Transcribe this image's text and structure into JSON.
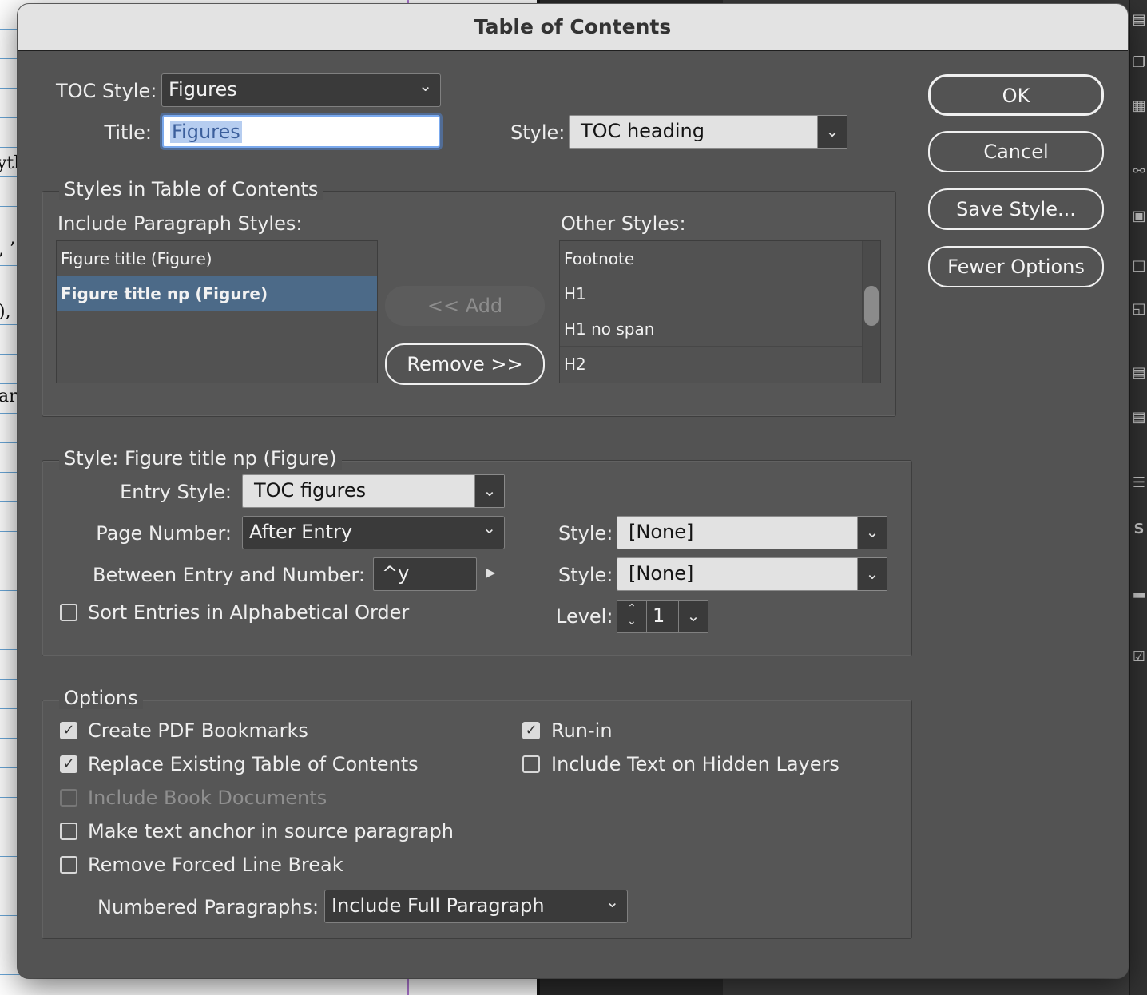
{
  "window": {
    "title": "Table of Contents"
  },
  "background_fragments": [
    "yth",
    ", ’",
    "),",
    "ar"
  ],
  "toc_style": {
    "label": "TOC Style:",
    "value": "Figures"
  },
  "title_field": {
    "label": "Title:",
    "value": "Figures"
  },
  "title_style": {
    "label": "Style:",
    "value": "TOC heading"
  },
  "buttons": {
    "ok": "OK",
    "cancel": "Cancel",
    "save_style": "Save Style...",
    "fewer_options": "Fewer Options",
    "add": "<< Add",
    "remove": "Remove >>"
  },
  "styles_section": {
    "title": "Styles in Table of Contents",
    "include_label": "Include Paragraph Styles:",
    "include_items": [
      "Figure title (Figure)",
      "Figure title np (Figure)"
    ],
    "selected_include": "Figure title np (Figure)",
    "other_label": "Other Styles:",
    "other_items": [
      "Footnote",
      "H1",
      "H1 no span",
      "H2"
    ]
  },
  "style_section": {
    "title": "Style: Figure title np (Figure)",
    "entry_style": {
      "label": "Entry Style:",
      "value": "TOC figures"
    },
    "page_number": {
      "label": "Page Number:",
      "value": "After Entry"
    },
    "page_number_style": {
      "label": "Style:",
      "value": "[None]"
    },
    "between": {
      "label": "Between Entry and Number:",
      "value": "^y"
    },
    "between_style": {
      "label": "Style:",
      "value": "[None]"
    },
    "sort": {
      "label": "Sort Entries in Alphabetical Order",
      "checked": false
    },
    "level": {
      "label": "Level:",
      "value": "1"
    }
  },
  "options": {
    "title": "Options",
    "create_pdf_bookmarks": {
      "label": "Create PDF Bookmarks",
      "checked": true
    },
    "replace_existing": {
      "label": "Replace Existing Table of Contents",
      "checked": true
    },
    "include_book": {
      "label": "Include Book Documents",
      "checked": false,
      "disabled": true
    },
    "make_anchor": {
      "label": "Make text anchor in source paragraph",
      "checked": false
    },
    "remove_forced": {
      "label": "Remove Forced Line Break",
      "checked": false
    },
    "run_in": {
      "label": "Run-in",
      "checked": true
    },
    "hidden_layers": {
      "label": "Include Text on Hidden Layers",
      "checked": false
    },
    "numbered_paragraphs": {
      "label": "Numbered Paragraphs:",
      "value": "Include Full Paragraph"
    }
  },
  "colors": {
    "dialog_bg": "#535353",
    "selection": "#4c6a88",
    "focus_ring": "#7aa9ee"
  },
  "toolbar_icons": [
    "panels-icon",
    "pages-icon",
    "layers-icon",
    "links-icon",
    "stroke-icon",
    "swatches-icon",
    "gradient-icon",
    "effects-icon",
    "align-icon",
    "pathfinder-icon",
    "paragraph-styles-icon",
    "character-styles-icon",
    "comments-icon",
    "tasks-icon"
  ]
}
